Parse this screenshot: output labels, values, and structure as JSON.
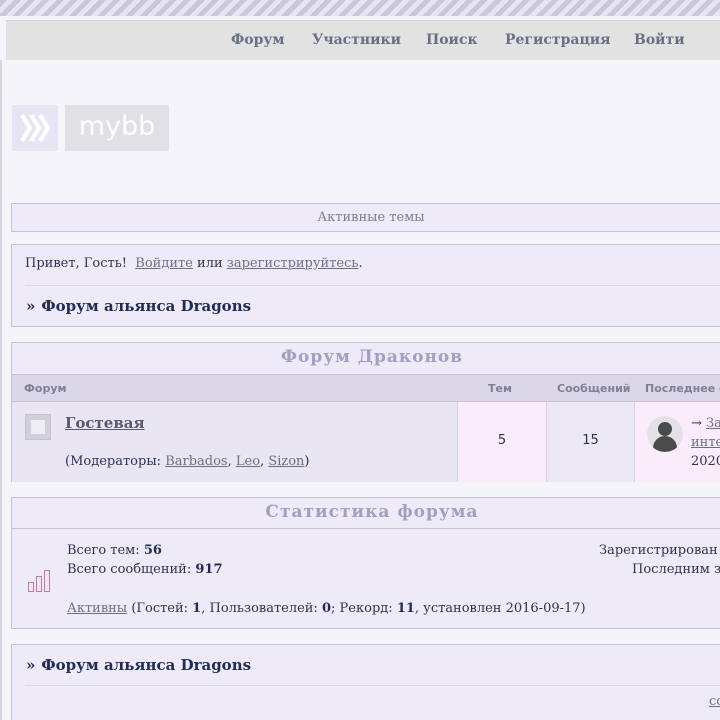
{
  "nav": {
    "items": [
      "Форум",
      "Участники",
      "Поиск",
      "Регистрация",
      "Войти"
    ]
  },
  "logo": {
    "text": "mybb"
  },
  "active_topics": {
    "label": "Активные темы"
  },
  "welcome": {
    "greeting": "Привет, Гость!",
    "login_link": "Войдите",
    "or": "или",
    "register_link": "зарегистрируйтесь",
    "end": ".",
    "crumb_prefix": "»",
    "crumb": "Форум альянса Dragons"
  },
  "forum_section": {
    "title": "Форум Драконов",
    "columns": {
      "forum": "Форум",
      "topics": "Тем",
      "posts": "Сообщений",
      "last": "Последнее с"
    },
    "row": {
      "name": "Гостевая",
      "mods_prefix": "(Модераторы:",
      "mods": [
        "Barbados",
        "Leo",
        "Sizon"
      ],
      "mods_suffix": ")",
      "topics": "5",
      "posts": "15",
      "last_arrow": "→",
      "last_line1": "За",
      "last_line2": "инте",
      "last_line3": "2020"
    }
  },
  "stats": {
    "title": "Статистика форума",
    "topics_label": "Всего тем:",
    "topics_value": "56",
    "posts_label": "Всего сообщений:",
    "posts_value": "917",
    "registered_label": "Зарегистрирован",
    "last_label": "Последним з",
    "online_link": "Активны",
    "guests_label": "(Гостей:",
    "guests_value": "1",
    "users_label": ", Пользователей:",
    "users_value": "0",
    "record_label": "; Рекорд:",
    "record_value": "11",
    "record_date": ", установлен 2016-09-17)"
  },
  "footer": {
    "crumb_prefix": "»",
    "crumb": "Форум альянса Dragons",
    "tail": "со"
  },
  "colors": {
    "accent": "#1e2c57",
    "panel": "#efeaf7",
    "title": "#a19fc2"
  }
}
